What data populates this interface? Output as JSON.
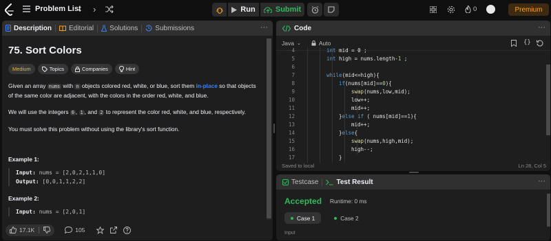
{
  "header": {
    "problem_list": "Problem List",
    "run": "Run",
    "submit": "Submit",
    "streak": "0",
    "premium": "Premium"
  },
  "description": {
    "tabs": [
      "Description",
      "Editorial",
      "Solutions",
      "Submissions"
    ],
    "title": "75. Sort Colors",
    "tags": [
      "Medium",
      "Topics",
      "Companies",
      "Hint"
    ],
    "para1_a": "Given an array ",
    "para1_code1": "nums",
    "para1_b": " with ",
    "para1_code2": "n",
    "para1_c": " objects colored red, white, or blue, sort them ",
    "para1_link": "in-place",
    "para1_d": " so that objects of the same color are adjacent, with the colors in the order red, white, and blue.",
    "para2_a": "We will use the integers ",
    "para2_code1": "0",
    "para2_b": ", ",
    "para2_code2": "1",
    "para2_c": ", and ",
    "para2_code3": "2",
    "para2_d": " to represent the color red, white, and blue, respectively.",
    "para3": "You must solve this problem without using the library's sort function.",
    "example1_title": "Example 1:",
    "example1_input_label": "Input:",
    "example1_input": " nums = [2,0,2,1,1,0]",
    "example1_output_label": "Output:",
    "example1_output": " [0,0,1,1,2,2]",
    "example2_title": "Example 2:",
    "example2_input_label": "Input:",
    "example2_input": " nums = [2,0,1]",
    "likes": "17.1K",
    "comments": "105"
  },
  "code": {
    "title": "Code",
    "language": "Java",
    "mode": "Auto",
    "lines": [
      {
        "n": "4",
        "indent": 0,
        "tokens": [
          [
            "kw",
            "int"
          ],
          [
            "t",
            " mid = 0 ;"
          ]
        ]
      },
      {
        "n": "5",
        "indent": 0,
        "tokens": [
          [
            "kw",
            "int"
          ],
          [
            "t",
            " high = nums.length-"
          ],
          [
            "num",
            "1"
          ],
          [
            "t",
            " ;"
          ]
        ]
      },
      {
        "n": "6",
        "indent": 0,
        "tokens": []
      },
      {
        "n": "7",
        "indent": 0,
        "tokens": [
          [
            "kw",
            "while"
          ],
          [
            "t",
            "(mid<=high){"
          ]
        ]
      },
      {
        "n": "8",
        "indent": 1,
        "tokens": [
          [
            "kw",
            "if"
          ],
          [
            "t",
            "(nums[mid]=="
          ],
          [
            "num",
            "0"
          ],
          [
            "t",
            "){"
          ]
        ]
      },
      {
        "n": "9",
        "indent": 2,
        "tokens": [
          [
            "fn",
            "swap"
          ],
          [
            "t",
            "(nums,low,mid);"
          ]
        ]
      },
      {
        "n": "10",
        "indent": 2,
        "tokens": [
          [
            "t",
            "low++;"
          ]
        ]
      },
      {
        "n": "11",
        "indent": 2,
        "tokens": [
          [
            "t",
            "mid++;"
          ]
        ]
      },
      {
        "n": "12",
        "indent": 1,
        "tokens": [
          [
            "t",
            "}"
          ],
          [
            "kw",
            "else if"
          ],
          [
            "t",
            " ( nums[mid]=="
          ],
          [
            "num",
            "1"
          ],
          [
            "t",
            "){"
          ]
        ]
      },
      {
        "n": "13",
        "indent": 2,
        "tokens": [
          [
            "t",
            "mid++;"
          ]
        ]
      },
      {
        "n": "14",
        "indent": 1,
        "tokens": [
          [
            "t",
            "}"
          ],
          [
            "kw",
            "else"
          ],
          [
            "t",
            "{"
          ]
        ]
      },
      {
        "n": "15",
        "indent": 2,
        "tokens": [
          [
            "fn",
            "swap"
          ],
          [
            "t",
            "(nums,high,mid);"
          ]
        ]
      },
      {
        "n": "16",
        "indent": 2,
        "tokens": [
          [
            "t",
            "high--;"
          ]
        ]
      },
      {
        "n": "17",
        "indent": 1,
        "tokens": [
          [
            "t",
            "}"
          ]
        ]
      }
    ],
    "saved": "Saved to local",
    "cursor": "Ln 28, Col 5"
  },
  "result": {
    "tab_testcase": "Testcase",
    "tab_result": "Test Result",
    "status": "Accepted",
    "runtime": "Runtime: 0 ms",
    "cases": [
      "Case 1",
      "Case 2"
    ],
    "input_label": "Input"
  },
  "colors": {
    "accepted": "#2cbb5d",
    "medium": "#ffb800",
    "premium": "#ffa116",
    "link": "#3b82f6"
  }
}
